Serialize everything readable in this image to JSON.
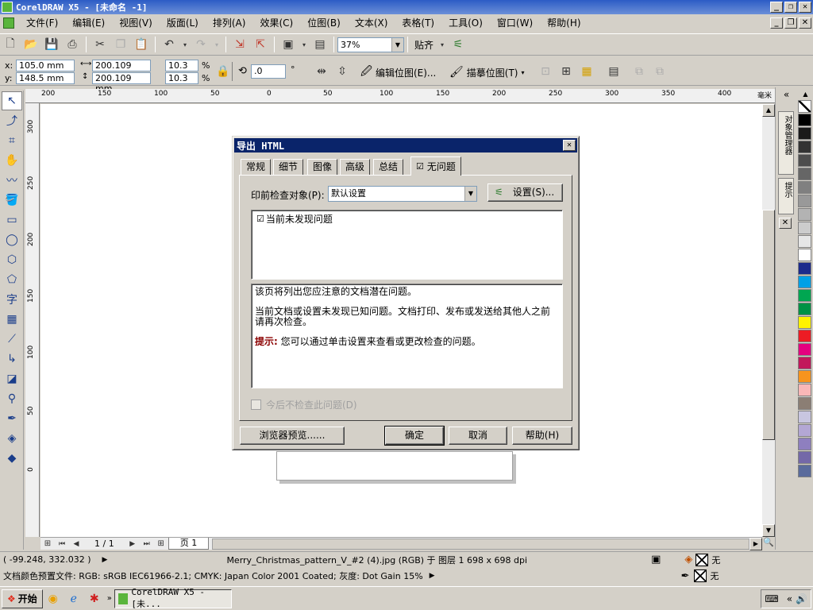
{
  "window": {
    "title": "CorelDRAW X5 - [未命名 -1]"
  },
  "menu": [
    "文件(F)",
    "编辑(E)",
    "视图(V)",
    "版面(L)",
    "排列(A)",
    "效果(C)",
    "位图(B)",
    "文本(X)",
    "表格(T)",
    "工具(O)",
    "窗口(W)",
    "帮助(H)"
  ],
  "toolbar": {
    "zoom": "37%",
    "snap_label": "贴齐"
  },
  "propbar": {
    "x_label": "x:",
    "x_value": "105.0 mm",
    "y_label": "y:",
    "y_value": "148.5 mm",
    "w_value": "200.109 mm",
    "h_value": "200.109 mm",
    "scale_x": "10.3",
    "scale_y": "10.3",
    "pct": "%",
    "angle": ".0",
    "deg": "°",
    "edit_bitmap": "编辑位图(E)...",
    "trace_bitmap": "描摹位图(T)"
  },
  "ruler": {
    "unit": "毫米",
    "h_ticks": [
      "200",
      "150",
      "100",
      "50",
      "0",
      "50",
      "100",
      "150",
      "200",
      "250",
      "300",
      "350",
      "400"
    ],
    "v_ticks": [
      "300",
      "250",
      "200",
      "150",
      "100",
      "50",
      "0"
    ]
  },
  "docker": {
    "tab1": "对象管理器",
    "tab2": "提示"
  },
  "palette": [
    "#ffffff",
    "#000000",
    "#1a1a1a",
    "#333333",
    "#4d4d4d",
    "#666666",
    "#808080",
    "#999999",
    "#b3b3b3",
    "#cccccc",
    "#e6e6e6",
    "#ffffff",
    "#1c2a8c",
    "#00a0e6",
    "#00a651",
    "#009245",
    "#fff200",
    "#ed1c24",
    "#e4007f",
    "#c2185b",
    "#f7941d",
    "#f9b7b7",
    "#8b7e74",
    "#c8c6e0",
    "#b3a7d4",
    "#8e7fbf",
    "#7468a8",
    "#5a6b9c"
  ],
  "pager": {
    "page_count": "1 / 1",
    "page_tab": "页 1"
  },
  "status": {
    "coords": "( -99.248, 332.032 )",
    "object_info": "Merry_Christmas_pattern_V_#2 (4).jpg (RGB) 于 图层 1 698 x 698 dpi",
    "fill_none": "无",
    "outline_none": "无",
    "color_profile": "文档颜色预置文件: RGB: sRGB IEC61966-2.1; CMYK: Japan Color 2001 Coated; 灰度: Dot Gain 15%"
  },
  "taskbar": {
    "start": "开始",
    "task_title": "CorelDRAW X5 - [未..."
  },
  "dialog": {
    "title": "导出 HTML",
    "tabs": [
      "常规",
      "细节",
      "图像",
      "高级",
      "总结",
      "无问题"
    ],
    "precheck_label": "印前检查对象(P):",
    "precheck_value": "默认设置",
    "settings_button": "设置(S)...",
    "issue_item": "当前未发现问题",
    "desc_line1": "该页将列出您应注意的文档潜在问题。",
    "desc_line2": "当前文档或设置未发现已知问题。文档打印、发布或发送给其他人之前请再次检查。",
    "tip_label": "提示:",
    "tip_text": "您可以通过单击设置来查看或更改检查的问题。",
    "dont_check_label": "今后不检查此问题(D)",
    "preview_button": "浏览器预览......",
    "ok_button": "确定",
    "cancel_button": "取消",
    "help_button": "帮助(H)"
  }
}
